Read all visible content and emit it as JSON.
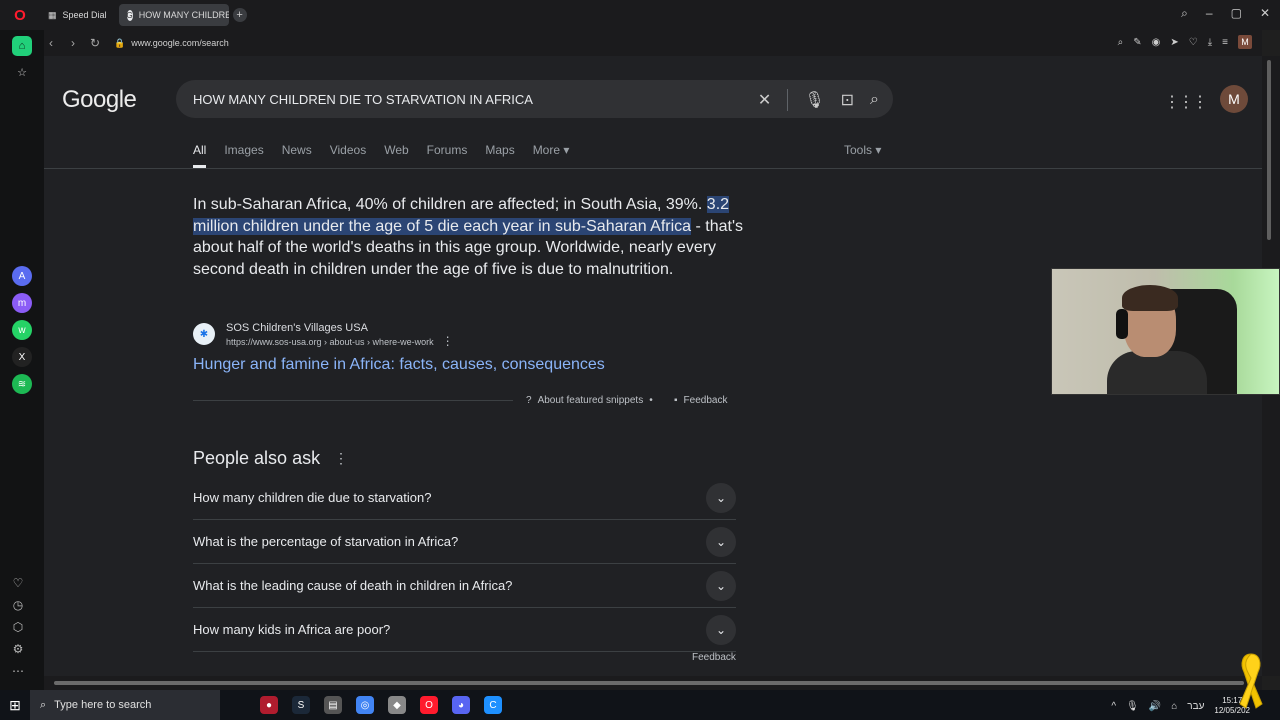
{
  "browser": {
    "tabs": [
      {
        "label": "Speed Dial",
        "icon": "speed-dial-icon"
      },
      {
        "label": "HOW MANY CHILDREN D",
        "icon": "google-icon"
      }
    ],
    "url": "www.google.com/search"
  },
  "google": {
    "logo": "Google",
    "query": "HOW MANY CHILDREN DIE TO STARVATION IN AFRICA",
    "avatar": "M",
    "tabs": [
      "All",
      "Images",
      "News",
      "Videos",
      "Web",
      "Forums",
      "Maps",
      "More ▾"
    ],
    "tools": "Tools ▾"
  },
  "snippet": {
    "text_before": "In sub-Saharan Africa, 40% of children are affected; in South Asia, 39%. ",
    "text_highlight": "3.2 million children under the age of 5 die each year in sub-Saharan Africa",
    "text_after": " - that's about half of the world's deaths in this age group. Worldwide, nearly every second death in children under the age of five is due to malnutrition.",
    "source_name": "SOS Children's Villages USA",
    "source_url": "https://www.sos-usa.org › about-us › where-we-work",
    "link": "Hunger and famine in Africa: facts, causes, consequences",
    "about": "About featured snippets",
    "feedback": "Feedback"
  },
  "paa": {
    "title": "People also ask",
    "questions": [
      "How many children die due to starvation?",
      "What is the percentage of starvation in Africa?",
      "What is the leading cause of death in children in Africa?",
      "How many kids in Africa are poor?"
    ],
    "feedback": "Feedback"
  },
  "taskbar": {
    "search_placeholder": "Type here to search",
    "lang": "עבר",
    "time": "15:17",
    "date": "12/05/202"
  }
}
